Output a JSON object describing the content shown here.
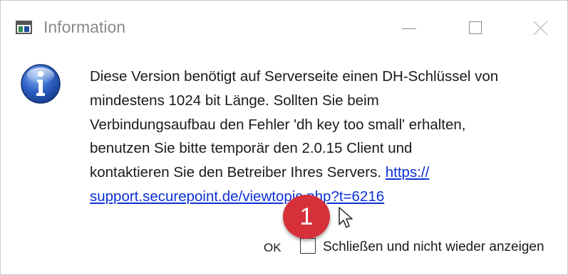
{
  "window": {
    "title": "Information",
    "controls": {
      "minimize": "minimize",
      "maximize": "maximize",
      "close": "close"
    }
  },
  "message": {
    "lines": [
      "Diese Version benötigt auf Serverseite einen DH-Schlüssel von",
      "mindestens 1024 bit Länge. Sollten Sie beim",
      "Verbindungsaufbau den Fehler 'dh key too small' erhalten,",
      "benutzen Sie bitte temporär den 2.0.15 Client und",
      "kontaktieren Sie den Betreiber Ihres Servers. "
    ],
    "link_part1": "https://",
    "link_part2": "support.securepoint.de/viewtopic.php?t=6216"
  },
  "footer": {
    "ok_label": "OK",
    "checkbox_label": "Schließen und nicht wieder anzeigen",
    "checkbox_checked": false
  },
  "annotation": {
    "badge_number": "1",
    "badge_color": "#d6303a"
  },
  "icons": {
    "app": "app-window-icon",
    "info": "info-icon",
    "cursor": "mouse-pointer-icon"
  }
}
